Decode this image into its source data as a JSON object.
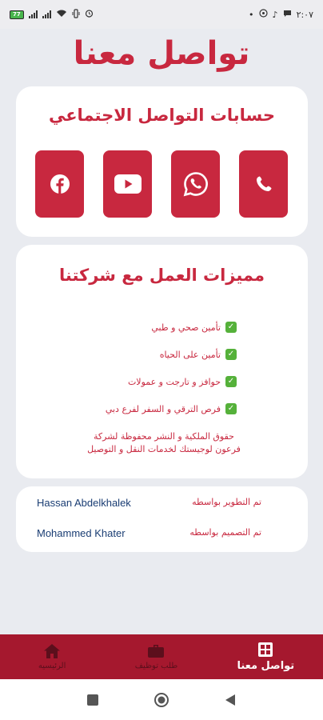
{
  "status_bar": {
    "time": "٢:٠٧",
    "battery": "77",
    "icons": [
      "battery-icon",
      "signal-icon",
      "wifi-icon",
      "vibrate-icon",
      "alarm-icon",
      "whatsapp-icon",
      "message-icon"
    ]
  },
  "page": {
    "title": "تواصل معنا"
  },
  "social": {
    "title": "حسابات التواصل الاجتماعي",
    "buttons": [
      {
        "name": "facebook",
        "icon": "facebook-icon"
      },
      {
        "name": "youtube",
        "icon": "youtube-icon"
      },
      {
        "name": "whatsapp",
        "icon": "whatsapp-icon"
      },
      {
        "name": "phone",
        "icon": "phone-icon"
      }
    ]
  },
  "features": {
    "title": "مميزات العمل مع شركتنا",
    "items": [
      "تأمين صحي و طبي",
      "تأمين على الحياه",
      "حوافز و تارجت و عمولات",
      "فرص الترقي و السفر لفرع دبي"
    ],
    "copyright_line1": "حقوق الملكية و النشر محفوظة لشركة",
    "copyright_line2": "فرعون لوجيستك لخدمات النقل و التوصيل"
  },
  "credits": {
    "developer_label": "تم التطوير بواسطه",
    "developer_name": "Hassan Abdelkhalek",
    "designer_label": "تم التصميم بواسطه",
    "designer_name": "Mohammed Khater"
  },
  "bottom_nav": {
    "items": [
      {
        "label": "تواصل معنا",
        "icon": "grid-icon",
        "active": true
      },
      {
        "label": "طلب توظيف",
        "icon": "briefcase-icon",
        "active": false
      },
      {
        "label": "الرئيسيه",
        "icon": "home-icon",
        "active": false
      }
    ]
  },
  "colors": {
    "accent": "#c8283f",
    "nav_background": "#a5182e",
    "page_background": "#e9ebf0",
    "card_background": "#ffffff",
    "credit_name": "#1a3d73",
    "check": "#55b13a"
  }
}
